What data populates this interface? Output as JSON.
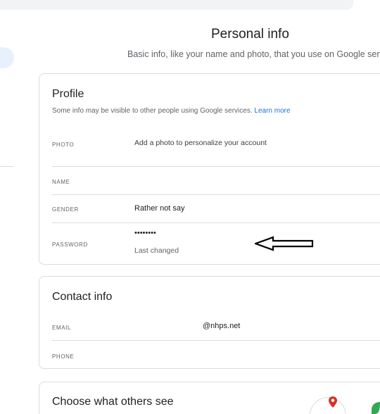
{
  "header": {
    "title": "Personal info",
    "subtitle": "Basic info, like your name and photo, that you use on Google services"
  },
  "profile": {
    "title": "Profile",
    "description": "Some info may be visible to other people using Google services.",
    "learn_more": "Learn more",
    "rows": {
      "photo": {
        "label": "PHOTO",
        "value": "Add a photo to personalize your account"
      },
      "name": {
        "label": "NAME",
        "value": ""
      },
      "gender": {
        "label": "GENDER",
        "value": "Rather not say"
      },
      "password": {
        "label": "PASSWORD",
        "value": "••••••••",
        "sub": "Last changed"
      }
    }
  },
  "contact": {
    "title": "Contact info",
    "rows": {
      "email": {
        "label": "EMAIL",
        "value": "@nhps.net"
      },
      "phone": {
        "label": "PHONE",
        "value": ""
      }
    }
  },
  "others": {
    "title": "Choose what others see"
  },
  "icons": {
    "annotation": "left-arrow-icon",
    "pin": "map-pin-icon",
    "leaf": "leaf-icon"
  },
  "colors": {
    "link": "#1a73e8",
    "border": "#dadce0",
    "pin": "#d93025",
    "leaf": "#34a853"
  }
}
